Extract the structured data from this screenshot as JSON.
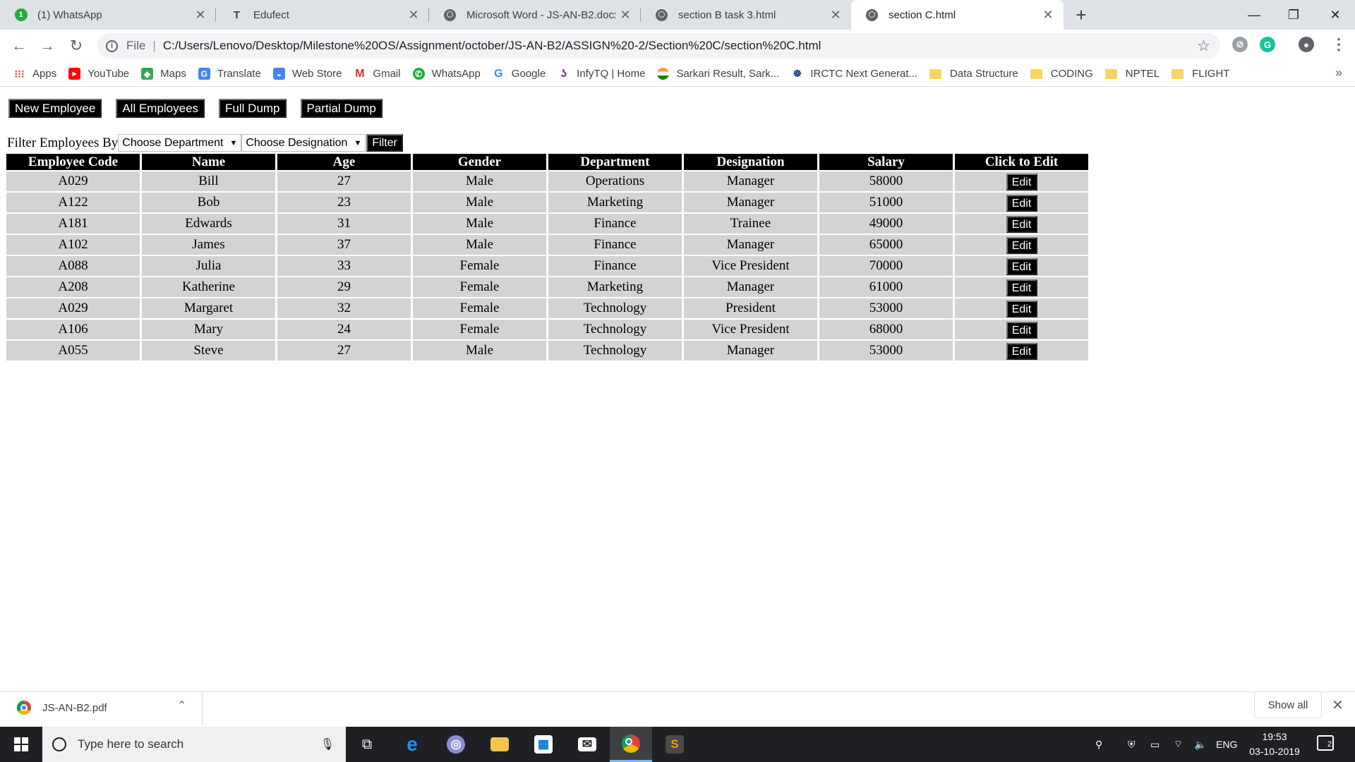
{
  "browser": {
    "tabs": [
      {
        "title": "(1) WhatsApp",
        "icon": "whatsapp-icon",
        "badge": "1"
      },
      {
        "title": "Edufect",
        "icon": "edufect-icon"
      },
      {
        "title": "Microsoft Word - JS-AN-B2.docx",
        "icon": "globe-icon"
      },
      {
        "title": "section B task 3.html",
        "icon": "globe-icon"
      },
      {
        "title": "section C.html",
        "icon": "globe-icon"
      }
    ],
    "address": {
      "scheme_label": "File",
      "url": "C:/Users/Lenovo/Desktop/Milestone%20OS/Assignment/october/JS-AN-B2/ASSIGN%20-2/Section%20C/section%20C.html"
    },
    "bookmarks": [
      {
        "label": "Apps",
        "icon": "apps-grid-icon"
      },
      {
        "label": "YouTube",
        "icon": "youtube-icon"
      },
      {
        "label": "Maps",
        "icon": "maps-icon"
      },
      {
        "label": "Translate",
        "icon": "translate-icon"
      },
      {
        "label": "Web Store",
        "icon": "webstore-icon"
      },
      {
        "label": "Gmail",
        "icon": "gmail-icon"
      },
      {
        "label": "WhatsApp",
        "icon": "whatsapp-icon"
      },
      {
        "label": "Google",
        "icon": "google-icon"
      },
      {
        "label": "InfyTQ | Home",
        "icon": "infytq-icon"
      },
      {
        "label": "Sarkari Result, Sark...",
        "icon": "sarkari-icon"
      },
      {
        "label": "IRCTC Next Generat...",
        "icon": "irctc-icon"
      },
      {
        "label": "Data Structure",
        "icon": "folder-icon"
      },
      {
        "label": "CODING",
        "icon": "folder-icon"
      },
      {
        "label": "NPTEL",
        "icon": "folder-icon"
      },
      {
        "label": "FLIGHT",
        "icon": "folder-icon"
      }
    ],
    "more_bookmarks": "»"
  },
  "page": {
    "buttons": {
      "new_employee": "New Employee",
      "all_employees": "All Employees",
      "full_dump": "Full Dump",
      "partial_dump": "Partial Dump"
    },
    "filter": {
      "label": "Filter Employees By",
      "department": "Choose Department",
      "designation": "Choose Designation",
      "button": "Filter"
    },
    "table": {
      "headers": [
        "Employee Code",
        "Name",
        "Age",
        "Gender",
        "Department",
        "Designation",
        "Salary",
        "Click to Edit"
      ],
      "edit_label": "Edit",
      "rows": [
        [
          "A029",
          "Bill",
          "27",
          "Male",
          "Operations",
          "Manager",
          "58000"
        ],
        [
          "A122",
          "Bob",
          "23",
          "Male",
          "Marketing",
          "Manager",
          "51000"
        ],
        [
          "A181",
          "Edwards",
          "31",
          "Male",
          "Finance",
          "Trainee",
          "49000"
        ],
        [
          "A102",
          "James",
          "37",
          "Male",
          "Finance",
          "Manager",
          "65000"
        ],
        [
          "A088",
          "Julia",
          "33",
          "Female",
          "Finance",
          "Vice President",
          "70000"
        ],
        [
          "A208",
          "Katherine",
          "29",
          "Female",
          "Marketing",
          "Manager",
          "61000"
        ],
        [
          "A029",
          "Margaret",
          "32",
          "Female",
          "Technology",
          "President",
          "53000"
        ],
        [
          "A106",
          "Mary",
          "24",
          "Female",
          "Technology",
          "Vice President",
          "68000"
        ],
        [
          "A055",
          "Steve",
          "27",
          "Male",
          "Technology",
          "Manager",
          "53000"
        ]
      ]
    }
  },
  "downloads": {
    "file": "JS-AN-B2.pdf",
    "show_all": "Show all"
  },
  "taskbar": {
    "search_placeholder": "Type here to search",
    "language": "ENG",
    "time": "19:53",
    "date": "03-10-2019",
    "notifications": "2"
  },
  "colors": {
    "tab_strip": "#dee1e6",
    "button_bg": "#000000",
    "cell_bg": "#d3d3d3",
    "taskbar": "#1f2023"
  }
}
